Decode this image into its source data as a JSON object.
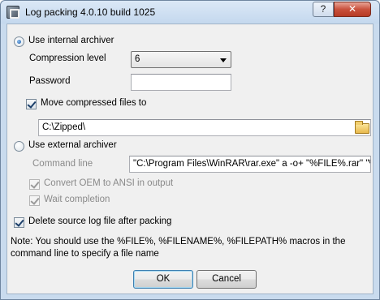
{
  "window": {
    "title": "Log packing 4.0.10 build 1025",
    "help_button": "?",
    "close_button": "✕"
  },
  "internal": {
    "radio_label": "Use internal archiver",
    "selected": true,
    "compression_label": "Compression level",
    "compression_value": "6",
    "password_label": "Password",
    "password_value": "",
    "move_label": "Move compressed files to",
    "move_checked": true,
    "move_path": "C:\\Zipped\\"
  },
  "external": {
    "radio_label": "Use external archiver",
    "selected": false,
    "command_label": "Command line",
    "command_value": "\"C:\\Program Files\\WinRAR\\rar.exe\" a -o+ \"%FILE%.rar\" \"%FI",
    "convert_label": "Convert OEM to ANSI in output",
    "convert_checked": true,
    "wait_label": "Wait completion",
    "wait_checked": true
  },
  "delete_source": {
    "label": "Delete source log file after packing",
    "checked": true
  },
  "note": "Note: You should use the %FILE%, %FILENAME%, %FILEPATH% macros in the command line to specify a file name",
  "buttons": {
    "ok": "OK",
    "cancel": "Cancel"
  },
  "icons": {
    "app": "log-packing-app-icon",
    "browse": "folder-icon",
    "dropdown": "chevron-down-icon"
  }
}
